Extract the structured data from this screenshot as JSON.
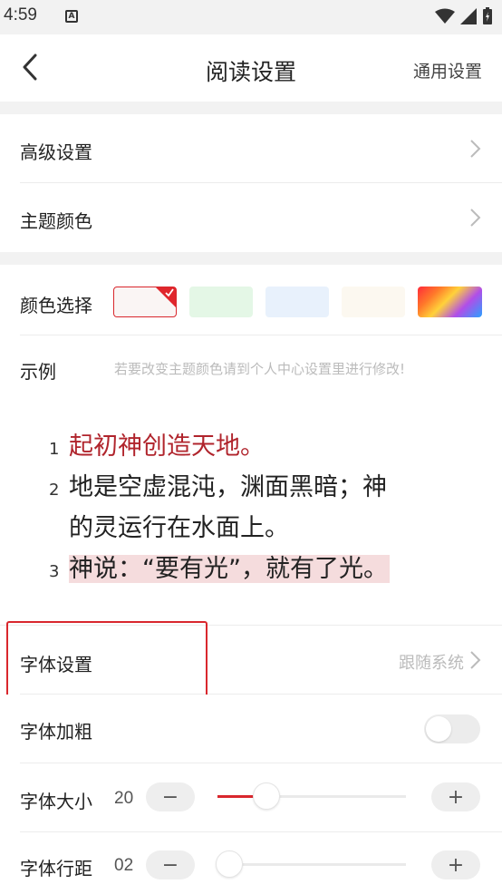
{
  "status": {
    "time": "4:59",
    "notif_icon_letter": "A"
  },
  "nav": {
    "title": "阅读设置",
    "right_label": "通用设置",
    "back_icon": "chevron-left-icon"
  },
  "settings": {
    "advanced": "高级设置",
    "theme_color": "主题颜色",
    "color_select": "颜色选择",
    "example": "示例",
    "example_hint": "若要改变主题颜色请到个人中心设置里进行修改!"
  },
  "colors": {
    "accent": "#d9272d",
    "swatches": [
      "#faf5f4",
      "#e4f7e6",
      "#e8f1fc",
      "#fcf8f0",
      "rainbow"
    ],
    "selected_index": 0
  },
  "preview": {
    "verses": [
      {
        "num": "1",
        "text": "起初神创造天地。"
      },
      {
        "num": "2",
        "text_line1": "地是空虚混沌，渊面黑暗；神",
        "text_line2": "的灵运行在水面上。"
      },
      {
        "num": "3",
        "text": "神说：“要有光”，就有了光。"
      }
    ]
  },
  "font": {
    "setting_label": "字体设置",
    "setting_value": "跟随系统",
    "bold_label": "字体加粗",
    "bold_on": false,
    "size_label": "字体大小",
    "size_value": "20",
    "size_fraction": 0.26,
    "spacing_label": "字体行距",
    "spacing_value": "02",
    "spacing_fraction": 0.0,
    "minus": "−",
    "plus": "+"
  }
}
